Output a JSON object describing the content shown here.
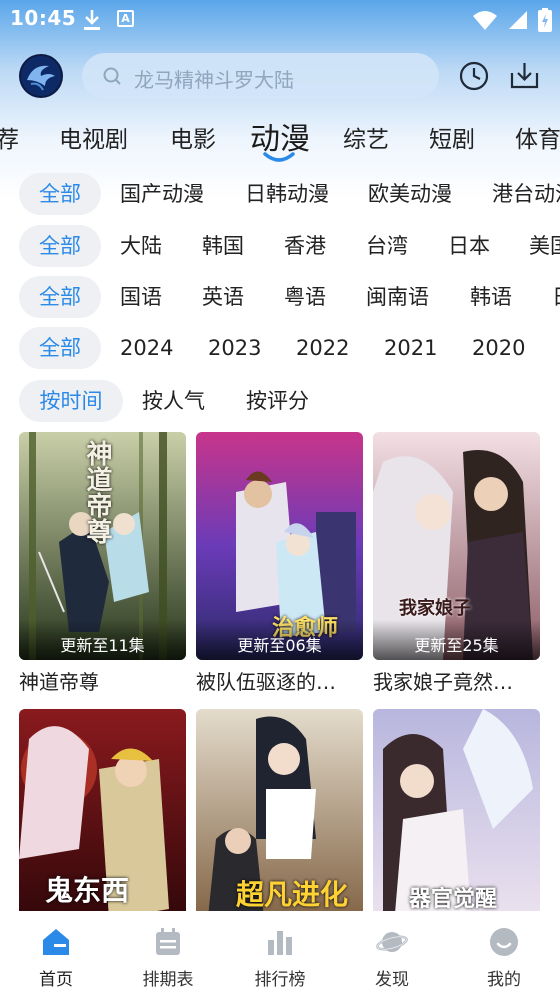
{
  "status_bar": {
    "time": "10:45",
    "app_badge": "A"
  },
  "header": {
    "search_placeholder": "龙马精神斗罗大陆"
  },
  "category_tabs": [
    "荐",
    "电视剧",
    "电影",
    "动漫",
    "综艺",
    "短剧",
    "体育"
  ],
  "active_tab": "动漫",
  "filters": {
    "type": {
      "selected": "全部",
      "options": [
        "国产动漫",
        "日韩动漫",
        "欧美动漫",
        "港台动漫"
      ]
    },
    "region": {
      "selected": "全部",
      "options": [
        "大陆",
        "韩国",
        "香港",
        "台湾",
        "日本",
        "美国"
      ]
    },
    "language": {
      "selected": "全部",
      "options": [
        "国语",
        "英语",
        "粤语",
        "闽南语",
        "韩语",
        "日"
      ]
    },
    "year": {
      "selected": "全部",
      "options": [
        "2024",
        "2023",
        "2022",
        "2021",
        "2020"
      ]
    },
    "sort": {
      "selected": "按时间",
      "options": [
        "按人气",
        "按评分"
      ]
    }
  },
  "cards": [
    {
      "title": "神道帝尊",
      "badge": "更新至11集",
      "cover_text": "神道帝尊"
    },
    {
      "title": "被队伍驱逐的…",
      "badge": "更新至06集",
      "cover_text": "治愈师"
    },
    {
      "title": "我家娘子竟然…",
      "badge": "更新至25集",
      "cover_text": "我家娘子"
    },
    {
      "title": "",
      "badge": "",
      "cover_text": "鬼东西"
    },
    {
      "title": "",
      "badge": "",
      "cover_text": "超凡进化"
    },
    {
      "title": "",
      "badge": "",
      "cover_text": "器官觉醒"
    }
  ],
  "bottom_nav": [
    {
      "label": "首页",
      "icon": "home-icon"
    },
    {
      "label": "排期表",
      "icon": "calendar-icon"
    },
    {
      "label": "排行榜",
      "icon": "ranking-icon"
    },
    {
      "label": "发现",
      "icon": "planet-icon"
    },
    {
      "label": "我的",
      "icon": "profile-icon"
    }
  ],
  "colors": {
    "accent": "#2b8ae8",
    "chip_bg": "#eef0f3",
    "header_blue": "#5aa6ea"
  }
}
